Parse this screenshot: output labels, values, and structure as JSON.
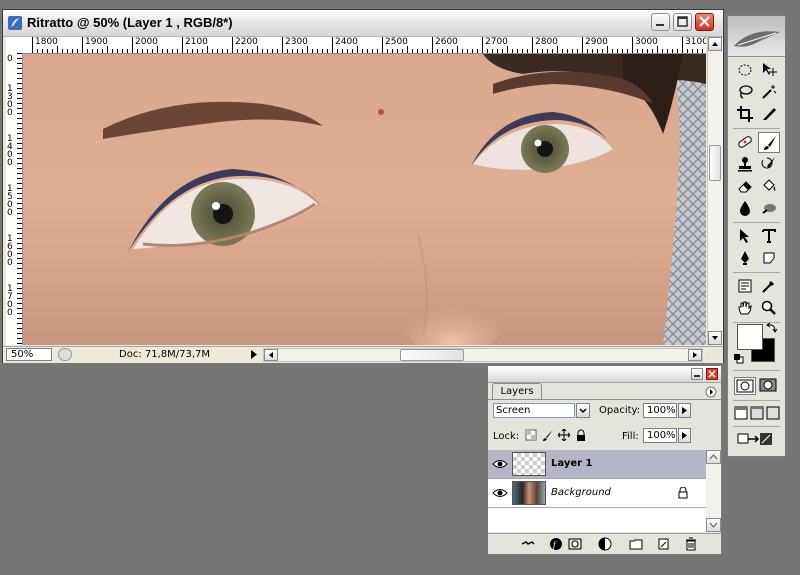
{
  "document_window": {
    "title": "Ritratto @ 50% (Layer 1 , RGB/8*)",
    "ruler_top_labels": [
      "1800",
      "1900",
      "2000",
      "2100",
      "2200",
      "2300",
      "2400",
      "2500",
      "2600",
      "2700",
      "2800",
      "2900",
      "3000",
      "3100"
    ],
    "ruler_left_labels": [
      "1300",
      "1400",
      "1500",
      "1600",
      "1700"
    ],
    "ruler_left_top": "0",
    "zoom": "50%",
    "doc_info": "Doc: 71,8M/73,7M"
  },
  "tools_panel": {
    "tools": [
      "marquee",
      "move",
      "lasso",
      "magic-wand",
      "crop",
      "slice",
      "healing-brush",
      "brush",
      "clone-stamp",
      "history-brush",
      "eraser",
      "paint-bucket",
      "blur",
      "dodge",
      "path-selection",
      "type",
      "pen",
      "custom-shape",
      "notes",
      "eyedropper",
      "hand",
      "zoom"
    ],
    "selected_tool": "brush",
    "foreground_color": "#ffffff",
    "background_color": "#000000"
  },
  "layers_panel": {
    "tab": "Layers",
    "blend_mode": "Screen",
    "opacity_label": "Opacity:",
    "opacity": "100%",
    "lock_label": "Lock:",
    "fill_label": "Fill:",
    "fill": "100%",
    "layers": [
      {
        "name": "Layer 1",
        "selected": true,
        "visible": true
      },
      {
        "name": "Background",
        "selected": false,
        "visible": true,
        "locked": true
      }
    ]
  }
}
